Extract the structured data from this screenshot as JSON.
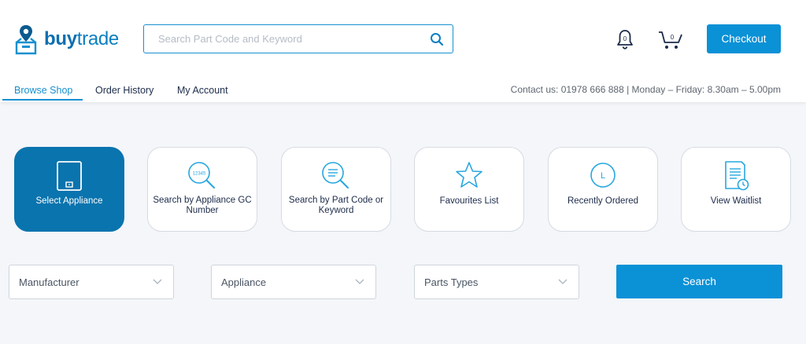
{
  "brand": {
    "name_bold": "buy",
    "name_rest": "trade",
    "color": "#0b7fc1"
  },
  "header": {
    "search_placeholder": "Search Part Code and Keyword",
    "search_icon": "search-icon",
    "notifications_count": "0",
    "cart_count": "0",
    "checkout_label": "Checkout"
  },
  "nav": {
    "items": [
      {
        "label": "Browse Shop",
        "active": true
      },
      {
        "label": "Order History",
        "active": false
      },
      {
        "label": "My Account",
        "active": false
      }
    ],
    "contact": "Contact us: 01978 666 888 | Monday – Friday: 8.30am – 5.00pm"
  },
  "tiles": [
    {
      "label": "Select Appliance",
      "icon": "appliance-icon",
      "active": true
    },
    {
      "label": "Search by Appliance GC Number",
      "icon": "gc-number-search-icon",
      "active": false
    },
    {
      "label": "Search by Part Code or Keyword",
      "icon": "keyword-search-icon",
      "active": false
    },
    {
      "label": "Favourites List",
      "icon": "star-icon",
      "active": false
    },
    {
      "label": "Recently Ordered",
      "icon": "clock-icon",
      "active": false
    },
    {
      "label": "View Waitlist",
      "icon": "waitlist-icon",
      "active": false
    }
  ],
  "gc_icon_text": "12345",
  "clock_icon_text": "L",
  "filters": {
    "manufacturer": "Manufacturer",
    "appliance": "Appliance",
    "parts_types": "Parts Types",
    "search_label": "Search"
  },
  "colors": {
    "accent": "#0a91d6",
    "active_tile": "#0a74ae",
    "page_bg": "#f4f6f9"
  }
}
